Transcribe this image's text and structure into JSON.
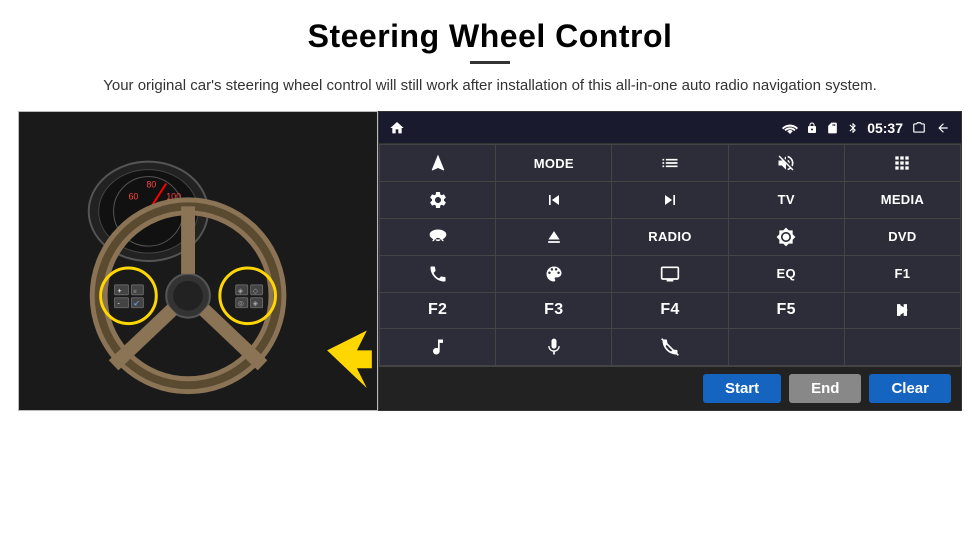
{
  "header": {
    "title": "Steering Wheel Control",
    "subtitle": "Your original car's steering wheel control will still work after installation of this all-in-one auto radio navigation system."
  },
  "status_bar": {
    "time": "05:37"
  },
  "grid_buttons": [
    {
      "id": "b1",
      "label": "",
      "icon": "navigate",
      "row": 1,
      "col": 1
    },
    {
      "id": "b2",
      "label": "MODE",
      "icon": "",
      "row": 1,
      "col": 2
    },
    {
      "id": "b3",
      "label": "",
      "icon": "list",
      "row": 1,
      "col": 3
    },
    {
      "id": "b4",
      "label": "",
      "icon": "mute",
      "row": 1,
      "col": 4
    },
    {
      "id": "b5",
      "label": "",
      "icon": "apps",
      "row": 1,
      "col": 5
    },
    {
      "id": "b6",
      "label": "",
      "icon": "settings-circle",
      "row": 2,
      "col": 1
    },
    {
      "id": "b7",
      "label": "",
      "icon": "prev",
      "row": 2,
      "col": 2
    },
    {
      "id": "b8",
      "label": "",
      "icon": "next",
      "row": 2,
      "col": 3
    },
    {
      "id": "b9",
      "label": "TV",
      "icon": "",
      "row": 2,
      "col": 4
    },
    {
      "id": "b10",
      "label": "MEDIA",
      "icon": "",
      "row": 2,
      "col": 5
    },
    {
      "id": "b11",
      "label": "",
      "icon": "360",
      "row": 3,
      "col": 1
    },
    {
      "id": "b12",
      "label": "",
      "icon": "eject",
      "row": 3,
      "col": 2
    },
    {
      "id": "b13",
      "label": "RADIO",
      "icon": "",
      "row": 3,
      "col": 3
    },
    {
      "id": "b14",
      "label": "",
      "icon": "brightness",
      "row": 3,
      "col": 4
    },
    {
      "id": "b15",
      "label": "DVD",
      "icon": "",
      "row": 3,
      "col": 5
    },
    {
      "id": "b16",
      "label": "",
      "icon": "phone",
      "row": 4,
      "col": 1
    },
    {
      "id": "b17",
      "label": "",
      "icon": "swirl",
      "row": 4,
      "col": 2
    },
    {
      "id": "b18",
      "label": "",
      "icon": "screen",
      "row": 4,
      "col": 3
    },
    {
      "id": "b19",
      "label": "EQ",
      "icon": "",
      "row": 4,
      "col": 4
    },
    {
      "id": "b20",
      "label": "F1",
      "icon": "",
      "row": 4,
      "col": 5
    },
    {
      "id": "b21",
      "label": "F2",
      "icon": "",
      "row": 5,
      "col": 1
    },
    {
      "id": "b22",
      "label": "F3",
      "icon": "",
      "row": 5,
      "col": 2
    },
    {
      "id": "b23",
      "label": "F4",
      "icon": "",
      "row": 5,
      "col": 3
    },
    {
      "id": "b24",
      "label": "F5",
      "icon": "",
      "row": 5,
      "col": 4
    },
    {
      "id": "b25",
      "label": "",
      "icon": "play-pause",
      "row": 5,
      "col": 5
    },
    {
      "id": "b26",
      "label": "",
      "icon": "music",
      "row": 6,
      "col": 1
    },
    {
      "id": "b27",
      "label": "",
      "icon": "mic",
      "row": 6,
      "col": 2
    },
    {
      "id": "b28",
      "label": "",
      "icon": "phone-mute",
      "row": 6,
      "col": 3
    },
    {
      "id": "b29",
      "label": "",
      "icon": "",
      "row": 6,
      "col": 4
    },
    {
      "id": "b30",
      "label": "",
      "icon": "",
      "row": 6,
      "col": 5
    }
  ],
  "bottom_buttons": {
    "start": "Start",
    "end": "End",
    "clear": "Clear"
  }
}
